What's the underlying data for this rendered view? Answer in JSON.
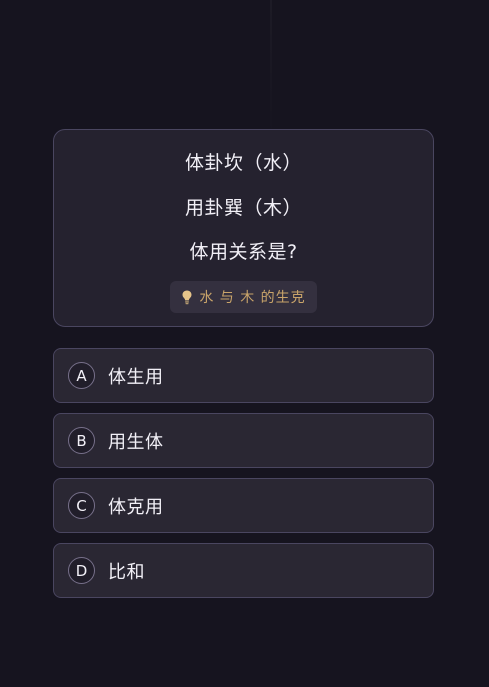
{
  "question": {
    "line1": "体卦坎（水）",
    "line2": "用卦巽（木）",
    "line3": "体用关系是?",
    "hint": {
      "icon": "lightbulb-icon",
      "text": "水 与 木 的生克",
      "color": "#c9a46a"
    }
  },
  "options": [
    {
      "letter": "A",
      "text": "体生用"
    },
    {
      "letter": "B",
      "text": "用生体"
    },
    {
      "letter": "C",
      "text": "体克用"
    },
    {
      "letter": "D",
      "text": "比和"
    }
  ],
  "theme": {
    "background": "#16141f",
    "card": "#25222f",
    "option": "#2a2733",
    "border": "#4a4660"
  }
}
